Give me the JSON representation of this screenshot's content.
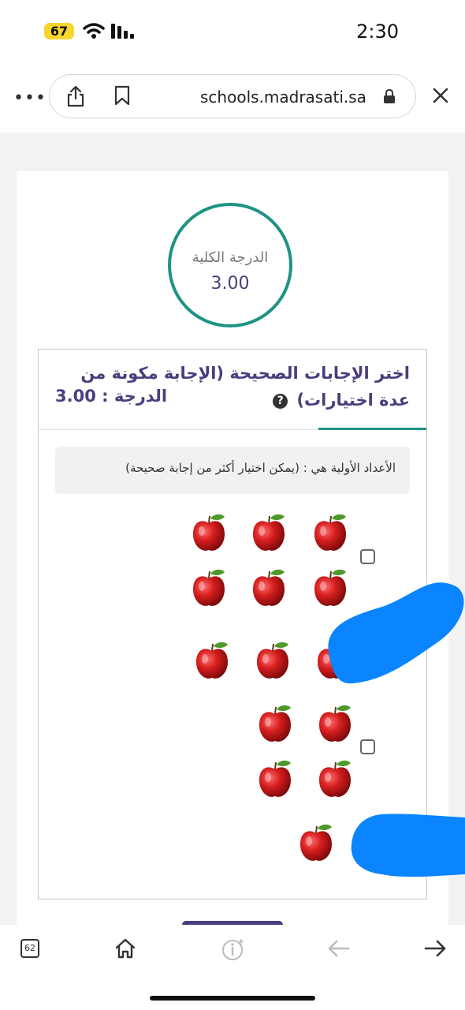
{
  "status_bar": {
    "battery": "67",
    "time": "2:30"
  },
  "browser": {
    "url": "schools.madrasati.sa",
    "tab_count": "62"
  },
  "score": {
    "label": "الدرجة الكلية",
    "value": "3.00"
  },
  "question": {
    "title": "اختر الإجابات الصحيحة (الإجابة مكونة من عدة اختيارات)",
    "help_icon": "?",
    "grade_label": "الدرجة : 3.00",
    "prompt": "الأعداد الأولية هي : (يمكن اختيار أكثر من إجابة صحيحة)",
    "options": [
      {
        "apple_count": 6,
        "checked": false
      },
      {
        "apple_count": 3,
        "checked": false
      },
      {
        "apple_count": 4,
        "checked": false
      },
      {
        "apple_count": 1,
        "checked": false
      }
    ]
  },
  "colors": {
    "accent_teal": "#1d9384",
    "title_purple": "#4b3d7d",
    "redaction_blue": "#0a84ff"
  }
}
